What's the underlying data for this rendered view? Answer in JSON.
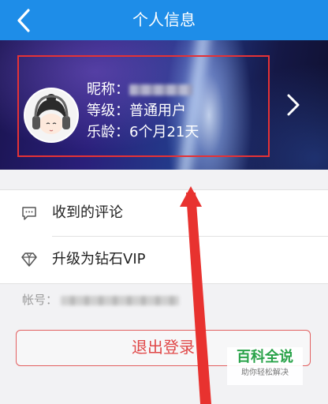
{
  "header": {
    "title": "个人信息",
    "back_icon": "chevron-left-icon"
  },
  "profile": {
    "nickname_label": "昵称：",
    "level_label": "等级：",
    "level_value": "普通用户",
    "age_label": "乐龄：",
    "age_value": "6个月21天",
    "avatar": "headphone-avatar-icon",
    "detail_icon": "chevron-right-icon"
  },
  "menu": {
    "items": [
      {
        "label": "收到的评论",
        "icon": "comment-icon"
      },
      {
        "label": "升级为钻石VIP",
        "icon": "diamond-icon"
      }
    ]
  },
  "account": {
    "label": "帐号："
  },
  "logout": {
    "label": "退出登录"
  },
  "watermark": {
    "main": "百科全说",
    "sub": "助你轻松解决"
  },
  "colors": {
    "nav_bar": "#1e8de8",
    "annotation": "#e53236",
    "logout_text": "#e04848",
    "watermark_green": "#2aa34a"
  }
}
